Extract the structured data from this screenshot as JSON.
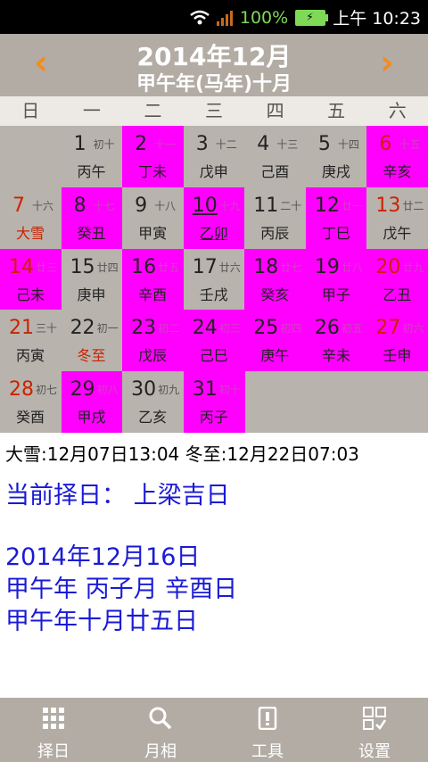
{
  "status": {
    "battery_pct": "100%",
    "time": "上午 10:23"
  },
  "header": {
    "title": "2014年12月",
    "subtitle": "甲午年(马年)十月",
    "prev_icon": "chevron-left-icon",
    "next_icon": "chevron-right-icon",
    "accent": "#f28c1e"
  },
  "weekdays": [
    "日",
    "一",
    "二",
    "三",
    "四",
    "五",
    "六"
  ],
  "calendar": {
    "highlight_color": "#ff00ff",
    "cells": [
      {
        "day": "1",
        "lunar": "初十",
        "ganzhi": "丙午",
        "col": 1,
        "row": 0,
        "pink": false
      },
      {
        "day": "2",
        "lunar": "十一",
        "ganzhi": "丁未",
        "col": 2,
        "row": 0,
        "pink": true
      },
      {
        "day": "3",
        "lunar": "十二",
        "ganzhi": "戊申",
        "col": 3,
        "row": 0,
        "pink": false
      },
      {
        "day": "4",
        "lunar": "十三",
        "ganzhi": "己酉",
        "col": 4,
        "row": 0,
        "pink": false
      },
      {
        "day": "5",
        "lunar": "十四",
        "ganzhi": "庚戌",
        "col": 5,
        "row": 0,
        "pink": false
      },
      {
        "day": "6",
        "lunar": "十五",
        "ganzhi": "辛亥",
        "col": 6,
        "row": 0,
        "pink": true,
        "redday": true
      },
      {
        "day": "7",
        "lunar": "十六",
        "ganzhi": "大雪",
        "col": 0,
        "row": 1,
        "pink": false,
        "redday": true,
        "redganzhi": true
      },
      {
        "day": "8",
        "lunar": "十七",
        "ganzhi": "癸丑",
        "col": 1,
        "row": 1,
        "pink": true
      },
      {
        "day": "9",
        "lunar": "十八",
        "ganzhi": "甲寅",
        "col": 2,
        "row": 1,
        "pink": false
      },
      {
        "day": "10",
        "lunar": "十九",
        "ganzhi": "乙卯",
        "col": 3,
        "row": 1,
        "pink": true,
        "underline": true
      },
      {
        "day": "11",
        "lunar": "二十",
        "ganzhi": "丙辰",
        "col": 4,
        "row": 1,
        "pink": false
      },
      {
        "day": "12",
        "lunar": "廿一",
        "ganzhi": "丁巳",
        "col": 5,
        "row": 1,
        "pink": true
      },
      {
        "day": "13",
        "lunar": "廿二",
        "ganzhi": "戊午",
        "col": 6,
        "row": 1,
        "pink": false,
        "redday": true
      },
      {
        "day": "14",
        "lunar": "廿三",
        "ganzhi": "己未",
        "col": 0,
        "row": 2,
        "pink": true,
        "redday": true
      },
      {
        "day": "15",
        "lunar": "廿四",
        "ganzhi": "庚申",
        "col": 1,
        "row": 2,
        "pink": false
      },
      {
        "day": "16",
        "lunar": "廿五",
        "ganzhi": "辛酉",
        "col": 2,
        "row": 2,
        "pink": true
      },
      {
        "day": "17",
        "lunar": "廿六",
        "ganzhi": "壬戌",
        "col": 3,
        "row": 2,
        "pink": false
      },
      {
        "day": "18",
        "lunar": "廿七",
        "ganzhi": "癸亥",
        "col": 4,
        "row": 2,
        "pink": true
      },
      {
        "day": "19",
        "lunar": "廿八",
        "ganzhi": "甲子",
        "col": 5,
        "row": 2,
        "pink": true
      },
      {
        "day": "20",
        "lunar": "廿九",
        "ganzhi": "乙丑",
        "col": 6,
        "row": 2,
        "pink": true,
        "redday": true
      },
      {
        "day": "21",
        "lunar": "三十",
        "ganzhi": "丙寅",
        "col": 0,
        "row": 3,
        "pink": false,
        "redday": true
      },
      {
        "day": "22",
        "lunar": "初一",
        "ganzhi": "冬至",
        "col": 1,
        "row": 3,
        "pink": false,
        "redganzhi": true
      },
      {
        "day": "23",
        "lunar": "初二",
        "ganzhi": "戊辰",
        "col": 2,
        "row": 3,
        "pink": true
      },
      {
        "day": "24",
        "lunar": "初三",
        "ganzhi": "己巳",
        "col": 3,
        "row": 3,
        "pink": true
      },
      {
        "day": "25",
        "lunar": "初四",
        "ganzhi": "庚午",
        "col": 4,
        "row": 3,
        "pink": true
      },
      {
        "day": "26",
        "lunar": "初五",
        "ganzhi": "辛未",
        "col": 5,
        "row": 3,
        "pink": true
      },
      {
        "day": "27",
        "lunar": "初六",
        "ganzhi": "壬申",
        "col": 6,
        "row": 3,
        "pink": true,
        "redday": true
      },
      {
        "day": "28",
        "lunar": "初七",
        "ganzhi": "癸酉",
        "col": 0,
        "row": 4,
        "pink": false,
        "redday": true
      },
      {
        "day": "29",
        "lunar": "初八",
        "ganzhi": "甲戌",
        "col": 1,
        "row": 4,
        "pink": true
      },
      {
        "day": "30",
        "lunar": "初九",
        "ganzhi": "乙亥",
        "col": 2,
        "row": 4,
        "pink": false
      },
      {
        "day": "31",
        "lunar": "初十",
        "ganzhi": "丙子",
        "col": 3,
        "row": 4,
        "pink": true
      }
    ]
  },
  "info": {
    "solar_terms": "大雪:12月07日13:04  冬至:12月22日07:03",
    "current_pick": "当前择日： 上梁吉日",
    "date_line1": "2014年12月16日",
    "date_line2": "甲午年 丙子月 辛酉日",
    "date_line3": "甲午年十月廿五日"
  },
  "tabs": [
    {
      "label": "择日",
      "icon": "grid-icon"
    },
    {
      "label": "月相",
      "icon": "search-icon"
    },
    {
      "label": "工具",
      "icon": "tool-icon"
    },
    {
      "label": "设置",
      "icon": "settings-icon"
    }
  ]
}
